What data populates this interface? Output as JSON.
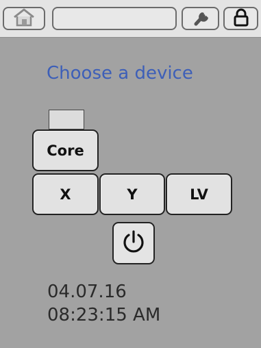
{
  "toolbar": {
    "home_icon": "home-icon",
    "title_value": "",
    "wrench_icon": "wrench-icon",
    "lock_icon": "lock-icon"
  },
  "main": {
    "heading": "Choose a device",
    "devices": {
      "core": "Core",
      "x": "X",
      "y": "Y",
      "lv": "LV"
    },
    "power_icon": "power-icon"
  },
  "status": {
    "date": "04.07.16",
    "time": "08:23:15 AM"
  },
  "colors": {
    "background": "#a2a2a2",
    "toolbar": "#e4e4e4",
    "heading": "#3d5fb8",
    "button": "#e2e2e2"
  }
}
